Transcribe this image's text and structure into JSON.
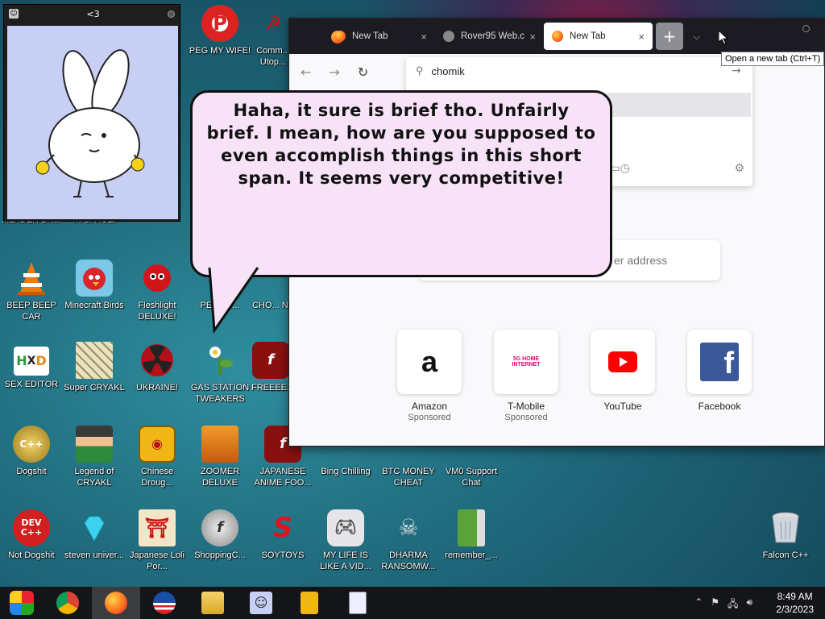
{
  "bunny_window": {
    "title": "<3"
  },
  "desktop_icons": [
    {
      "label": "PEG MY WIFE!"
    },
    {
      "label": "Comm... Utop..."
    },
    {
      "label": "...LADEN BR..."
    },
    {
      "label": "IN SPACE!"
    },
    {
      "label": "BEEP BEEP CAR"
    },
    {
      "label": "Minecraft Birds"
    },
    {
      "label": "Fleshlight DELUXE!"
    },
    {
      "label": "PE... ST..."
    },
    {
      "label": "CHO... NUTS..."
    },
    {
      "label": "SEX EDITOR"
    },
    {
      "label": "Super CRYAKL"
    },
    {
      "label": "UKRAINE!"
    },
    {
      "label": "GAS STATION TWEAKERS"
    },
    {
      "label": "FREEEE..."
    },
    {
      "label": "Dogshit"
    },
    {
      "label": "Legend of CRYAKL"
    },
    {
      "label": "Chinese Droug..."
    },
    {
      "label": "ZOOMER DELUXE"
    },
    {
      "label": "JAPANESE ANIME FOO..."
    },
    {
      "label": "Bing Chilling"
    },
    {
      "label": "BTC MONEY CHEAT"
    },
    {
      "label": "VM0 Support Chat"
    },
    {
      "label": "Not Dogshit"
    },
    {
      "label": "steven univer..."
    },
    {
      "label": "Japanese Loli Por..."
    },
    {
      "label": "ShoppingC..."
    },
    {
      "label": "SOYTOYS"
    },
    {
      "label": "MY LIFE IS LIKE A VID..."
    },
    {
      "label": "DHARMA RANSOMW..."
    },
    {
      "label": "remember_..."
    },
    {
      "label": "Falcon C++"
    }
  ],
  "browser": {
    "tabs": [
      {
        "label": "New Tab",
        "close": "×"
      },
      {
        "label": "Rover95 Web.c",
        "close": "×"
      },
      {
        "label": "New Tab",
        "close": "×"
      }
    ],
    "new_tab_symbol": "+",
    "tooltip": "Open a new tab (Ctrl+T)",
    "url_text": "chomik",
    "search_placeholder": "er address",
    "top_sites": [
      {
        "name": "Amazon",
        "sponsored": "Sponsored",
        "logo": "a"
      },
      {
        "name": "T-Mobile",
        "sponsored": "Sponsored",
        "logo": "5G HOME INTERNET"
      },
      {
        "name": "YouTube",
        "sponsored": "",
        "logo": "play-icon"
      },
      {
        "name": "Facebook",
        "sponsored": "",
        "logo": "f"
      }
    ]
  },
  "speech_bubble": {
    "text": "Haha, it sure is brief tho. Unfairly brief. I mean, how are you supposed to even accomplish things in this short span. It seems very competitive!"
  },
  "taskbar": {
    "time": "8:49 AM",
    "date": "2/3/2023"
  },
  "colors": {
    "desktop_teal": "#1f6a7c",
    "bubble_pink": "#f7e2f7",
    "bunny_bg": "#c8cff5",
    "tab_strip": "#1c1b22"
  }
}
